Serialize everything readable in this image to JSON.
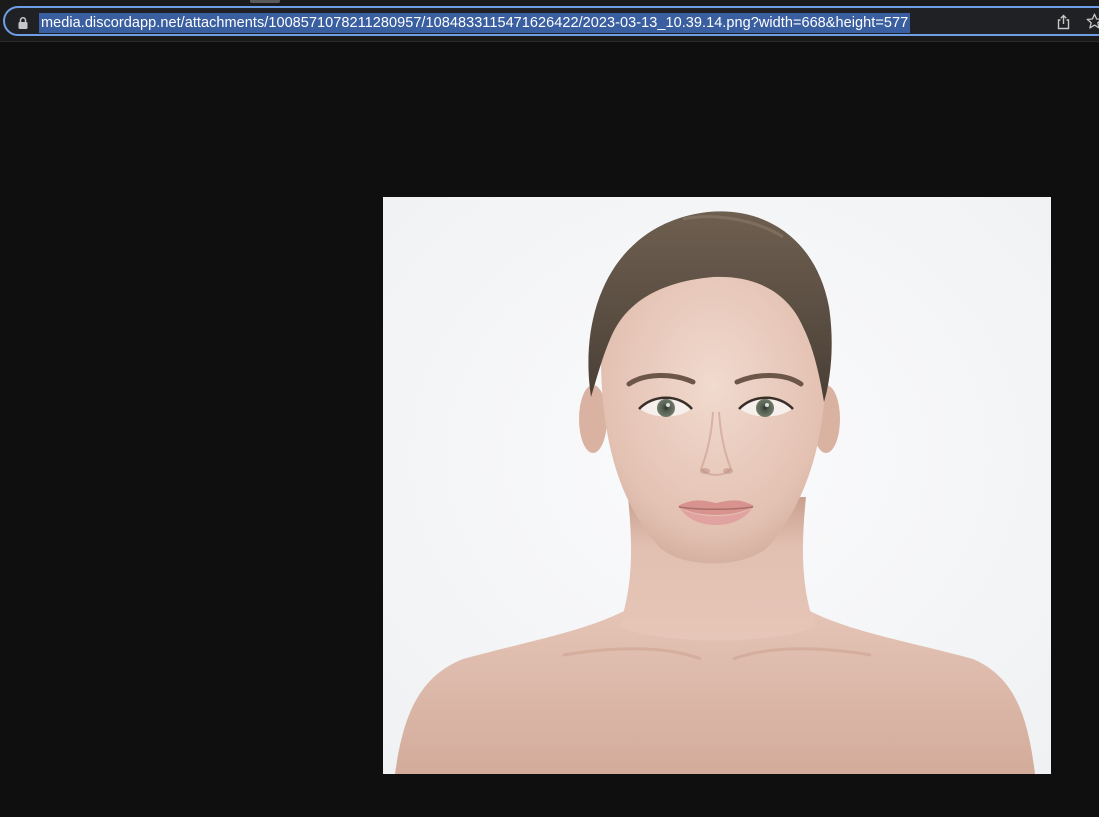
{
  "browser": {
    "address_bar": {
      "url": "media.discordapp.net/attachments/1008571078211280957/1084833115471626422/2023-03-13_10.39.14.png?width=668&height=577",
      "selected": true,
      "lock_icon": "lock-icon"
    },
    "actions": {
      "share_icon": "share-icon",
      "bookmark_icon": "star-icon"
    },
    "accent_color": "#6e9fe6",
    "selection_color": "#3a5fa0"
  },
  "viewer": {
    "background_color": "#0f0f0f",
    "image": {
      "subject": "portrait",
      "background_color": "#f4f5f6"
    }
  }
}
